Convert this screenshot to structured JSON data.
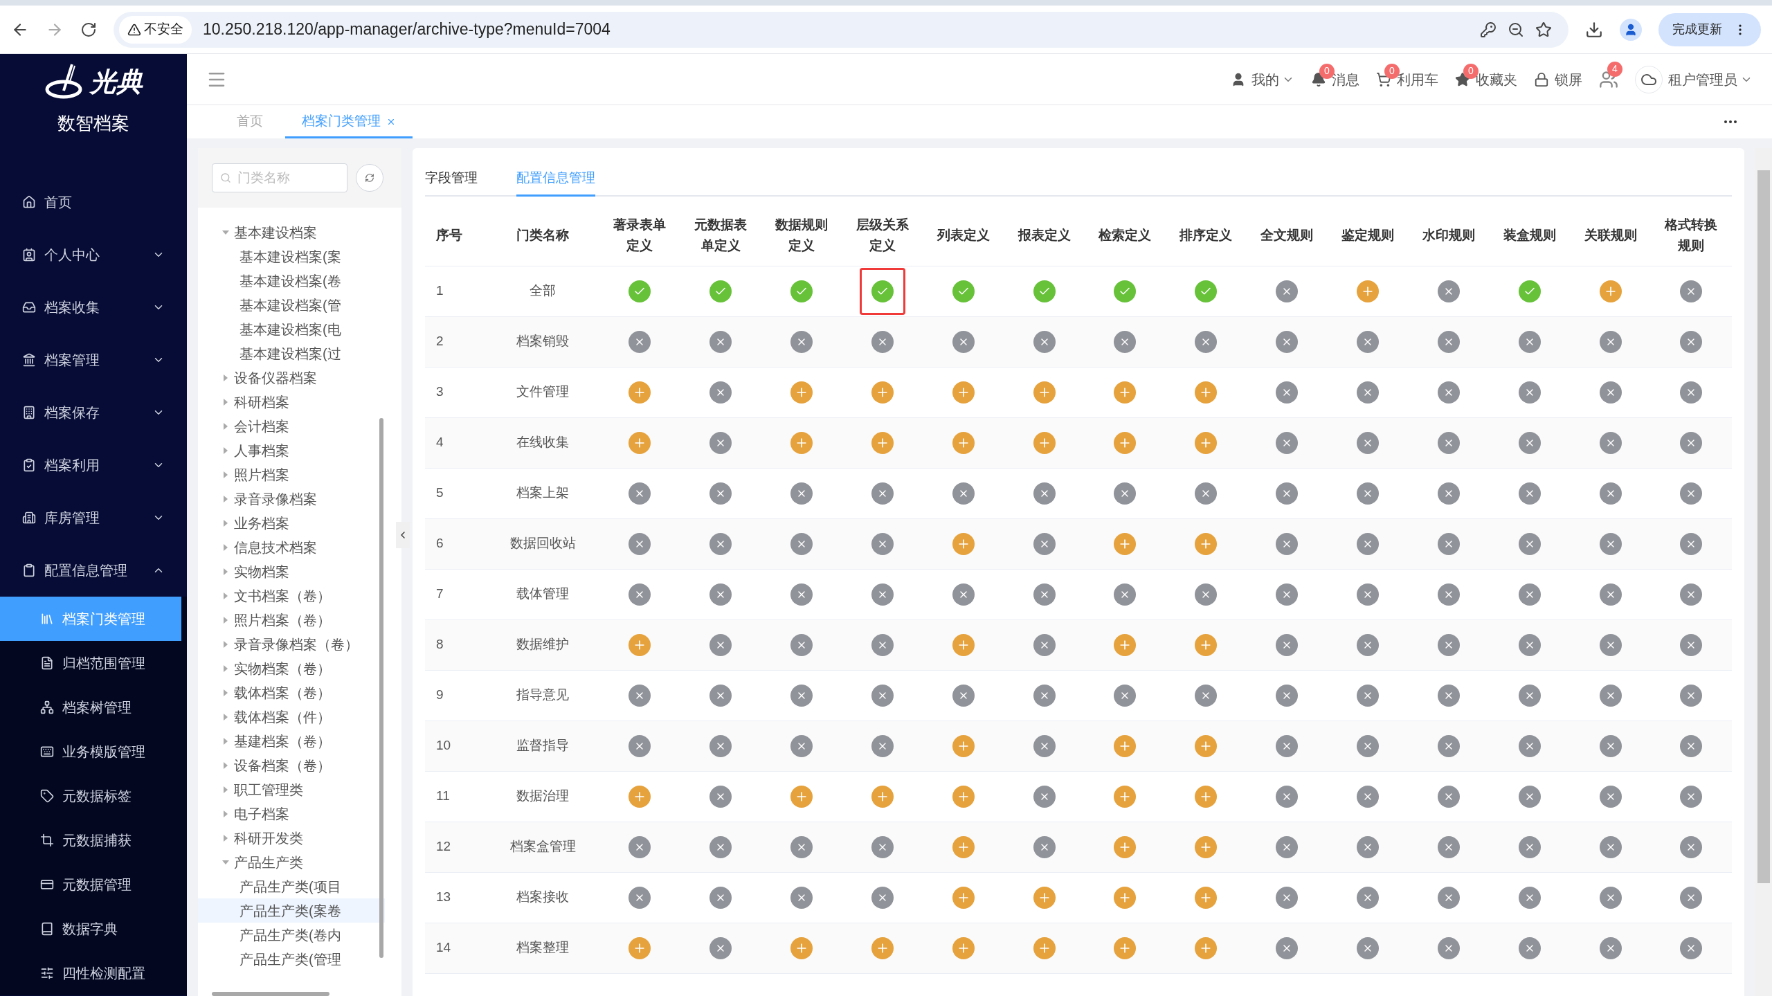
{
  "browser": {
    "security": "不安全",
    "url": "10.250.218.120/app-manager/archive-type?menuId=7004",
    "update_button": "完成更新"
  },
  "brand": {
    "logo_text": "光典",
    "product": "数智档案"
  },
  "sidebar": {
    "items": [
      {
        "label": "首页",
        "kind": "link",
        "selected": false
      },
      {
        "label": "个人中心",
        "kind": "group",
        "expanded": false,
        "selected": false
      },
      {
        "label": "档案收集",
        "kind": "group",
        "expanded": false,
        "selected": false
      },
      {
        "label": "档案管理",
        "kind": "group",
        "expanded": false,
        "selected": false
      },
      {
        "label": "档案保存",
        "kind": "group",
        "expanded": false,
        "selected": false
      },
      {
        "label": "档案利用",
        "kind": "group",
        "expanded": false,
        "selected": false
      },
      {
        "label": "库房管理",
        "kind": "group",
        "expanded": false,
        "selected": false
      },
      {
        "label": "配置信息管理",
        "kind": "group",
        "expanded": true,
        "selected": false,
        "children": [
          {
            "label": "档案门类管理",
            "selected": true
          },
          {
            "label": "归档范围管理",
            "selected": false
          },
          {
            "label": "档案树管理",
            "selected": false
          },
          {
            "label": "业务模版管理",
            "selected": false
          },
          {
            "label": "元数据标签",
            "selected": false
          },
          {
            "label": "元数据捕获",
            "selected": false
          },
          {
            "label": "元数据管理",
            "selected": false
          },
          {
            "label": "数据字典",
            "selected": false
          },
          {
            "label": "四性检测配置",
            "selected": false
          }
        ]
      }
    ]
  },
  "header": {
    "items": [
      {
        "kind": "user",
        "label": "我的"
      },
      {
        "kind": "bell",
        "label": "消息",
        "badge": "0"
      },
      {
        "kind": "cart",
        "label": "利用车",
        "badge": "0"
      },
      {
        "kind": "star",
        "label": "收藏夹",
        "badge": "0"
      },
      {
        "kind": "lock",
        "label": "锁屏"
      },
      {
        "kind": "users",
        "badge": "4"
      },
      {
        "kind": "tenant",
        "label": "租户管理员"
      }
    ]
  },
  "page_tabs": [
    {
      "label": "首页",
      "selected": false,
      "closable": false
    },
    {
      "label": "档案门类管理",
      "selected": true,
      "closable": true
    }
  ],
  "tree": {
    "search": {
      "placeholder": "门类名称"
    },
    "items": [
      {
        "label": "基本建设档案",
        "expanded": true,
        "selected": false,
        "children": [
          {
            "label": "基本建设档案(案",
            "selected": false
          },
          {
            "label": "基本建设档案(卷",
            "selected": false
          },
          {
            "label": "基本建设档案(管",
            "selected": false
          },
          {
            "label": "基本建设档案(电",
            "selected": false
          },
          {
            "label": "基本建设档案(过",
            "selected": false
          }
        ]
      },
      {
        "label": "设备仪器档案",
        "expanded": false,
        "selected": false
      },
      {
        "label": "科研档案",
        "expanded": false,
        "selected": false
      },
      {
        "label": "会计档案",
        "expanded": false,
        "selected": false
      },
      {
        "label": "人事档案",
        "expanded": false,
        "selected": false
      },
      {
        "label": "照片档案",
        "expanded": false,
        "selected": false
      },
      {
        "label": "录音录像档案",
        "expanded": false,
        "selected": false
      },
      {
        "label": "业务档案",
        "expanded": false,
        "selected": false
      },
      {
        "label": "信息技术档案",
        "expanded": false,
        "selected": false
      },
      {
        "label": "实物档案",
        "expanded": false,
        "selected": false
      },
      {
        "label": "文书档案（卷）",
        "expanded": false,
        "selected": false
      },
      {
        "label": "照片档案（卷）",
        "expanded": false,
        "selected": false
      },
      {
        "label": "录音录像档案（卷）",
        "expanded": false,
        "selected": false
      },
      {
        "label": "实物档案（卷）",
        "expanded": false,
        "selected": false
      },
      {
        "label": "载体档案（卷）",
        "expanded": false,
        "selected": false
      },
      {
        "label": "载体档案（件）",
        "expanded": false,
        "selected": false
      },
      {
        "label": "基建档案（卷）",
        "expanded": false,
        "selected": false
      },
      {
        "label": "设备档案（卷）",
        "expanded": false,
        "selected": false
      },
      {
        "label": "职工管理类",
        "expanded": false,
        "selected": false
      },
      {
        "label": "电子档案",
        "expanded": false,
        "selected": false
      },
      {
        "label": "科研开发类",
        "expanded": false,
        "selected": false
      },
      {
        "label": "产品生产类",
        "expanded": true,
        "selected": false,
        "children": [
          {
            "label": "产品生产类(项目",
            "selected": false
          },
          {
            "label": "产品生产类(案卷",
            "selected": true
          },
          {
            "label": "产品生产类(卷内",
            "selected": false
          },
          {
            "label": "产品生产类(管理",
            "selected": false
          }
        ]
      }
    ]
  },
  "content_tabs": [
    {
      "label": "字段管理",
      "selected": false
    },
    {
      "label": "配置信息管理",
      "selected": true
    }
  ],
  "table": {
    "columns": [
      "序号",
      "门类名称",
      "著录表单定义",
      "元数据表单定义",
      "数据规则定义",
      "层级关系定义",
      "列表定义",
      "报表定义",
      "检索定义",
      "排序定义",
      "全文规则",
      "鉴定规则",
      "水印规则",
      "装盒规则",
      "关联规则",
      "格式转换规则"
    ],
    "rows": [
      {
        "index": "1",
        "name": "全部",
        "cells": [
          {
            "kind": "check",
            "outlined": false
          },
          {
            "kind": "check",
            "outlined": false
          },
          {
            "kind": "check",
            "outlined": false
          },
          {
            "kind": "check",
            "outlined": true
          },
          {
            "kind": "check",
            "outlined": false
          },
          {
            "kind": "check",
            "outlined": false
          },
          {
            "kind": "check",
            "outlined": false
          },
          {
            "kind": "check",
            "outlined": false
          },
          {
            "kind": "cross",
            "outlined": false
          },
          {
            "kind": "plus",
            "outlined": false
          },
          {
            "kind": "cross",
            "outlined": false
          },
          {
            "kind": "check",
            "outlined": false
          },
          {
            "kind": "plus",
            "outlined": false
          },
          {
            "kind": "cross",
            "outlined": false
          }
        ]
      },
      {
        "index": "2",
        "name": "档案销毁",
        "cells": [
          {
            "kind": "cross",
            "outlined": false
          },
          {
            "kind": "cross",
            "outlined": false
          },
          {
            "kind": "cross",
            "outlined": false
          },
          {
            "kind": "cross",
            "outlined": false
          },
          {
            "kind": "cross",
            "outlined": false
          },
          {
            "kind": "cross",
            "outlined": false
          },
          {
            "kind": "cross",
            "outlined": false
          },
          {
            "kind": "cross",
            "outlined": false
          },
          {
            "kind": "cross",
            "outlined": false
          },
          {
            "kind": "cross",
            "outlined": false
          },
          {
            "kind": "cross",
            "outlined": false
          },
          {
            "kind": "cross",
            "outlined": false
          },
          {
            "kind": "cross",
            "outlined": false
          },
          {
            "kind": "cross",
            "outlined": false
          }
        ]
      },
      {
        "index": "3",
        "name": "文件管理",
        "cells": [
          {
            "kind": "plus",
            "outlined": false
          },
          {
            "kind": "cross",
            "outlined": false
          },
          {
            "kind": "plus",
            "outlined": false
          },
          {
            "kind": "plus",
            "outlined": false
          },
          {
            "kind": "plus",
            "outlined": false
          },
          {
            "kind": "plus",
            "outlined": false
          },
          {
            "kind": "plus",
            "outlined": false
          },
          {
            "kind": "plus",
            "outlined": false
          },
          {
            "kind": "cross",
            "outlined": false
          },
          {
            "kind": "cross",
            "outlined": false
          },
          {
            "kind": "cross",
            "outlined": false
          },
          {
            "kind": "cross",
            "outlined": false
          },
          {
            "kind": "cross",
            "outlined": false
          },
          {
            "kind": "cross",
            "outlined": false
          }
        ]
      },
      {
        "index": "4",
        "name": "在线收集",
        "cells": [
          {
            "kind": "plus",
            "outlined": false
          },
          {
            "kind": "cross",
            "outlined": false
          },
          {
            "kind": "plus",
            "outlined": false
          },
          {
            "kind": "plus",
            "outlined": false
          },
          {
            "kind": "plus",
            "outlined": false
          },
          {
            "kind": "plus",
            "outlined": false
          },
          {
            "kind": "plus",
            "outlined": false
          },
          {
            "kind": "plus",
            "outlined": false
          },
          {
            "kind": "cross",
            "outlined": false
          },
          {
            "kind": "cross",
            "outlined": false
          },
          {
            "kind": "cross",
            "outlined": false
          },
          {
            "kind": "cross",
            "outlined": false
          },
          {
            "kind": "cross",
            "outlined": false
          },
          {
            "kind": "cross",
            "outlined": false
          }
        ]
      },
      {
        "index": "5",
        "name": "档案上架",
        "cells": [
          {
            "kind": "cross",
            "outlined": false
          },
          {
            "kind": "cross",
            "outlined": false
          },
          {
            "kind": "cross",
            "outlined": false
          },
          {
            "kind": "cross",
            "outlined": false
          },
          {
            "kind": "cross",
            "outlined": false
          },
          {
            "kind": "cross",
            "outlined": false
          },
          {
            "kind": "cross",
            "outlined": false
          },
          {
            "kind": "cross",
            "outlined": false
          },
          {
            "kind": "cross",
            "outlined": false
          },
          {
            "kind": "cross",
            "outlined": false
          },
          {
            "kind": "cross",
            "outlined": false
          },
          {
            "kind": "cross",
            "outlined": false
          },
          {
            "kind": "cross",
            "outlined": false
          },
          {
            "kind": "cross",
            "outlined": false
          }
        ]
      },
      {
        "index": "6",
        "name": "数据回收站",
        "cells": [
          {
            "kind": "cross",
            "outlined": false
          },
          {
            "kind": "cross",
            "outlined": false
          },
          {
            "kind": "cross",
            "outlined": false
          },
          {
            "kind": "cross",
            "outlined": false
          },
          {
            "kind": "plus",
            "outlined": false
          },
          {
            "kind": "cross",
            "outlined": false
          },
          {
            "kind": "plus",
            "outlined": false
          },
          {
            "kind": "plus",
            "outlined": false
          },
          {
            "kind": "cross",
            "outlined": false
          },
          {
            "kind": "cross",
            "outlined": false
          },
          {
            "kind": "cross",
            "outlined": false
          },
          {
            "kind": "cross",
            "outlined": false
          },
          {
            "kind": "cross",
            "outlined": false
          },
          {
            "kind": "cross",
            "outlined": false
          }
        ]
      },
      {
        "index": "7",
        "name": "载体管理",
        "cells": [
          {
            "kind": "cross",
            "outlined": false
          },
          {
            "kind": "cross",
            "outlined": false
          },
          {
            "kind": "cross",
            "outlined": false
          },
          {
            "kind": "cross",
            "outlined": false
          },
          {
            "kind": "cross",
            "outlined": false
          },
          {
            "kind": "cross",
            "outlined": false
          },
          {
            "kind": "cross",
            "outlined": false
          },
          {
            "kind": "cross",
            "outlined": false
          },
          {
            "kind": "cross",
            "outlined": false
          },
          {
            "kind": "cross",
            "outlined": false
          },
          {
            "kind": "cross",
            "outlined": false
          },
          {
            "kind": "cross",
            "outlined": false
          },
          {
            "kind": "cross",
            "outlined": false
          },
          {
            "kind": "cross",
            "outlined": false
          }
        ]
      },
      {
        "index": "8",
        "name": "数据维护",
        "cells": [
          {
            "kind": "plus",
            "outlined": false
          },
          {
            "kind": "cross",
            "outlined": false
          },
          {
            "kind": "cross",
            "outlined": false
          },
          {
            "kind": "cross",
            "outlined": false
          },
          {
            "kind": "plus",
            "outlined": false
          },
          {
            "kind": "cross",
            "outlined": false
          },
          {
            "kind": "plus",
            "outlined": false
          },
          {
            "kind": "plus",
            "outlined": false
          },
          {
            "kind": "cross",
            "outlined": false
          },
          {
            "kind": "cross",
            "outlined": false
          },
          {
            "kind": "cross",
            "outlined": false
          },
          {
            "kind": "cross",
            "outlined": false
          },
          {
            "kind": "cross",
            "outlined": false
          },
          {
            "kind": "cross",
            "outlined": false
          }
        ]
      },
      {
        "index": "9",
        "name": "指导意见",
        "cells": [
          {
            "kind": "cross",
            "outlined": false
          },
          {
            "kind": "cross",
            "outlined": false
          },
          {
            "kind": "cross",
            "outlined": false
          },
          {
            "kind": "cross",
            "outlined": false
          },
          {
            "kind": "cross",
            "outlined": false
          },
          {
            "kind": "cross",
            "outlined": false
          },
          {
            "kind": "cross",
            "outlined": false
          },
          {
            "kind": "cross",
            "outlined": false
          },
          {
            "kind": "cross",
            "outlined": false
          },
          {
            "kind": "cross",
            "outlined": false
          },
          {
            "kind": "cross",
            "outlined": false
          },
          {
            "kind": "cross",
            "outlined": false
          },
          {
            "kind": "cross",
            "outlined": false
          },
          {
            "kind": "cross",
            "outlined": false
          }
        ]
      },
      {
        "index": "10",
        "name": "监督指导",
        "cells": [
          {
            "kind": "cross",
            "outlined": false
          },
          {
            "kind": "cross",
            "outlined": false
          },
          {
            "kind": "cross",
            "outlined": false
          },
          {
            "kind": "cross",
            "outlined": false
          },
          {
            "kind": "plus",
            "outlined": false
          },
          {
            "kind": "cross",
            "outlined": false
          },
          {
            "kind": "plus",
            "outlined": false
          },
          {
            "kind": "plus",
            "outlined": false
          },
          {
            "kind": "cross",
            "outlined": false
          },
          {
            "kind": "cross",
            "outlined": false
          },
          {
            "kind": "cross",
            "outlined": false
          },
          {
            "kind": "cross",
            "outlined": false
          },
          {
            "kind": "cross",
            "outlined": false
          },
          {
            "kind": "cross",
            "outlined": false
          }
        ]
      },
      {
        "index": "11",
        "name": "数据治理",
        "cells": [
          {
            "kind": "plus",
            "outlined": false
          },
          {
            "kind": "cross",
            "outlined": false
          },
          {
            "kind": "plus",
            "outlined": false
          },
          {
            "kind": "plus",
            "outlined": false
          },
          {
            "kind": "plus",
            "outlined": false
          },
          {
            "kind": "cross",
            "outlined": false
          },
          {
            "kind": "plus",
            "outlined": false
          },
          {
            "kind": "plus",
            "outlined": false
          },
          {
            "kind": "cross",
            "outlined": false
          },
          {
            "kind": "cross",
            "outlined": false
          },
          {
            "kind": "cross",
            "outlined": false
          },
          {
            "kind": "cross",
            "outlined": false
          },
          {
            "kind": "cross",
            "outlined": false
          },
          {
            "kind": "cross",
            "outlined": false
          }
        ]
      },
      {
        "index": "12",
        "name": "档案盒管理",
        "cells": [
          {
            "kind": "cross",
            "outlined": false
          },
          {
            "kind": "cross",
            "outlined": false
          },
          {
            "kind": "cross",
            "outlined": false
          },
          {
            "kind": "cross",
            "outlined": false
          },
          {
            "kind": "plus",
            "outlined": false
          },
          {
            "kind": "cross",
            "outlined": false
          },
          {
            "kind": "plus",
            "outlined": false
          },
          {
            "kind": "plus",
            "outlined": false
          },
          {
            "kind": "cross",
            "outlined": false
          },
          {
            "kind": "cross",
            "outlined": false
          },
          {
            "kind": "cross",
            "outlined": false
          },
          {
            "kind": "cross",
            "outlined": false
          },
          {
            "kind": "cross",
            "outlined": false
          },
          {
            "kind": "cross",
            "outlined": false
          }
        ]
      },
      {
        "index": "13",
        "name": "档案接收",
        "cells": [
          {
            "kind": "cross",
            "outlined": false
          },
          {
            "kind": "cross",
            "outlined": false
          },
          {
            "kind": "cross",
            "outlined": false
          },
          {
            "kind": "cross",
            "outlined": false
          },
          {
            "kind": "plus",
            "outlined": false
          },
          {
            "kind": "plus",
            "outlined": false
          },
          {
            "kind": "plus",
            "outlined": false
          },
          {
            "kind": "plus",
            "outlined": false
          },
          {
            "kind": "cross",
            "outlined": false
          },
          {
            "kind": "cross",
            "outlined": false
          },
          {
            "kind": "cross",
            "outlined": false
          },
          {
            "kind": "cross",
            "outlined": false
          },
          {
            "kind": "cross",
            "outlined": false
          },
          {
            "kind": "cross",
            "outlined": false
          }
        ]
      },
      {
        "index": "14",
        "name": "档案整理",
        "cells": [
          {
            "kind": "plus",
            "outlined": false
          },
          {
            "kind": "cross",
            "outlined": false
          },
          {
            "kind": "plus",
            "outlined": false
          },
          {
            "kind": "plus",
            "outlined": false
          },
          {
            "kind": "plus",
            "outlined": false
          },
          {
            "kind": "plus",
            "outlined": false
          },
          {
            "kind": "plus",
            "outlined": false
          },
          {
            "kind": "plus",
            "outlined": false
          },
          {
            "kind": "cross",
            "outlined": false
          },
          {
            "kind": "cross",
            "outlined": false
          },
          {
            "kind": "cross",
            "outlined": false
          },
          {
            "kind": "cross",
            "outlined": false
          },
          {
            "kind": "cross",
            "outlined": false
          },
          {
            "kind": "cross",
            "outlined": false
          }
        ]
      }
    ]
  }
}
